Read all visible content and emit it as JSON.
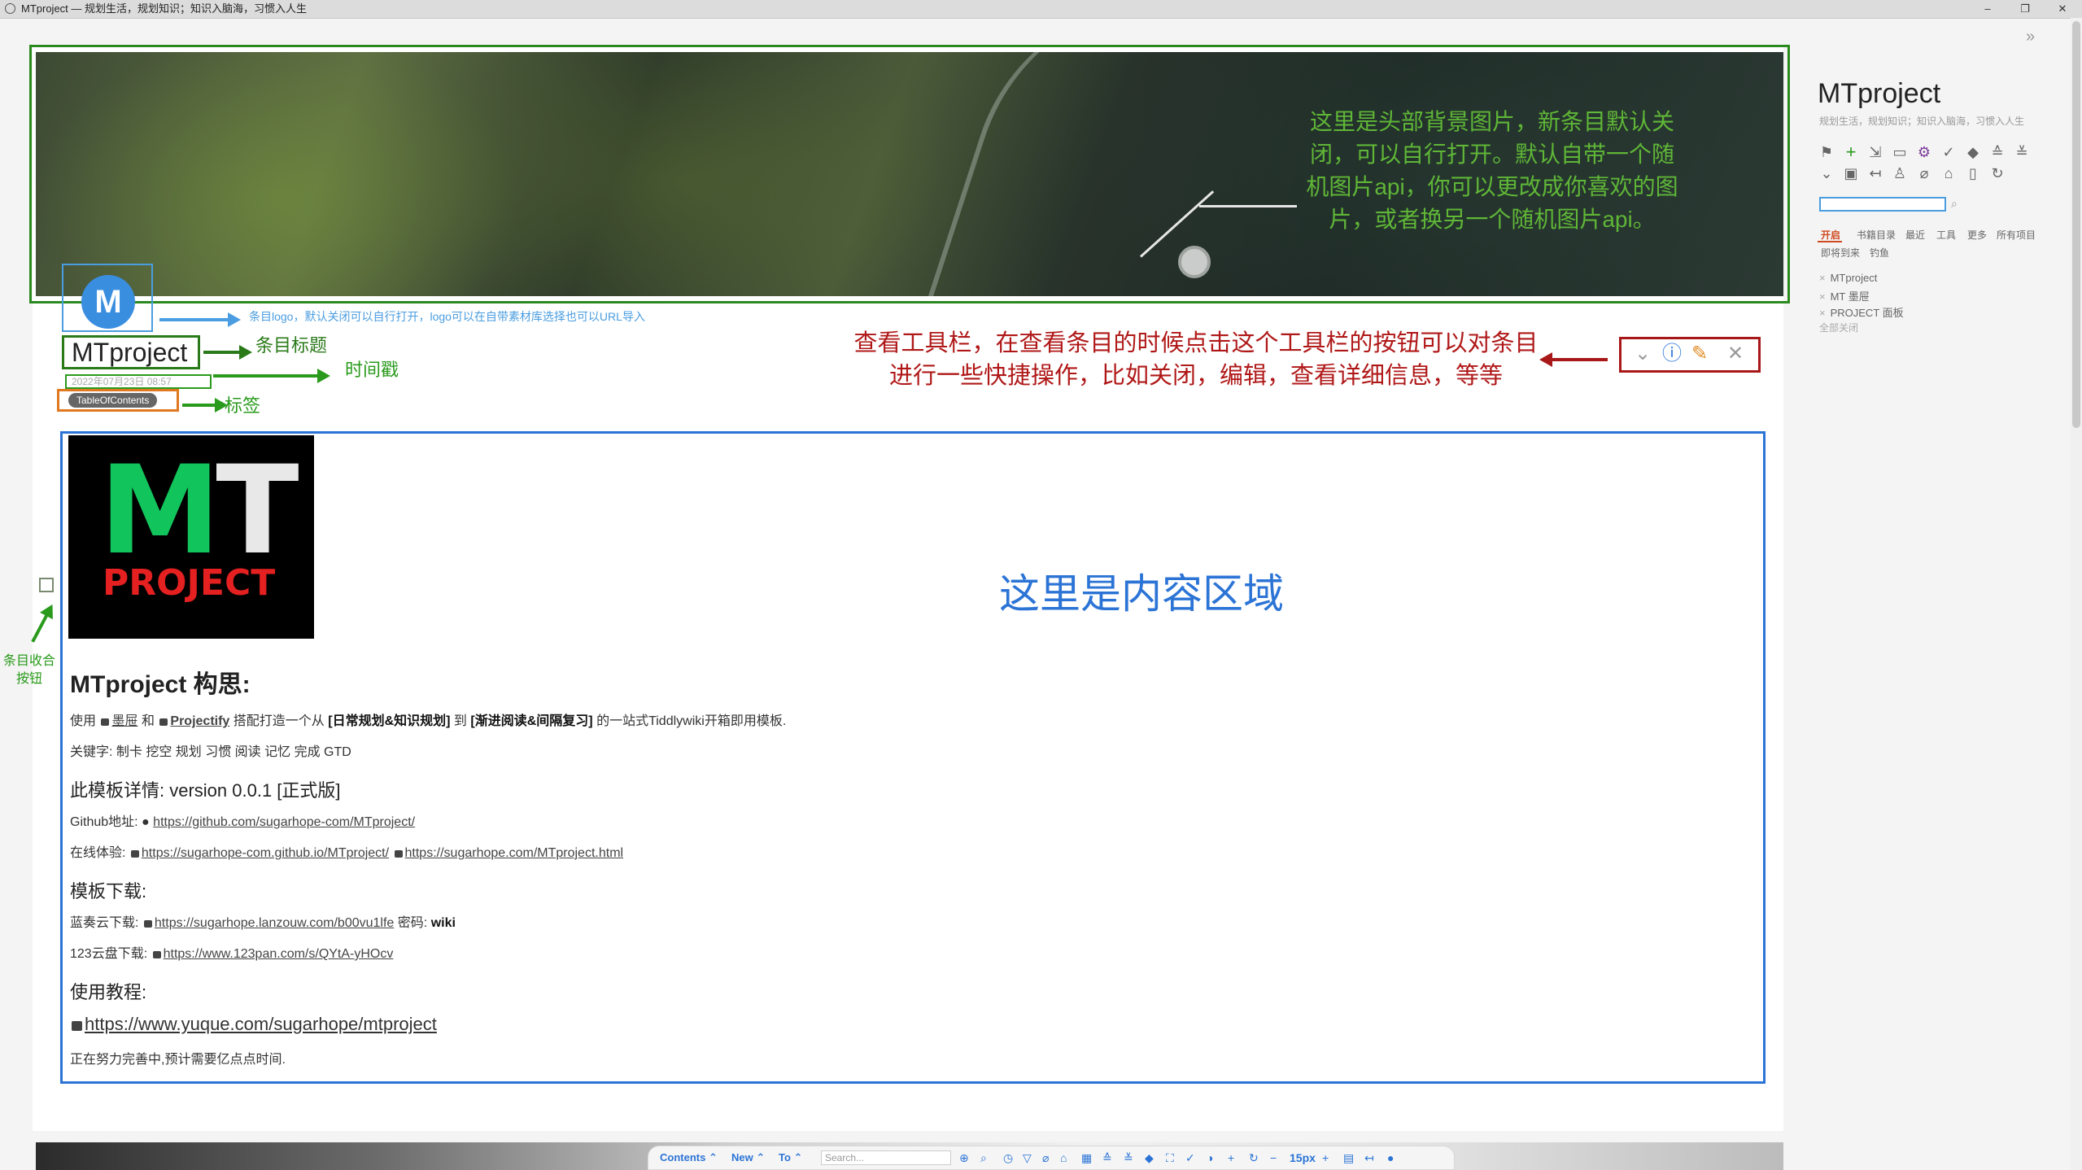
{
  "window": {
    "title": "MTproject — 规划生活，规划知识；知识入脑海，习惯入人生",
    "min": "–",
    "max": "❐",
    "close": "✕"
  },
  "header": {
    "annotation": "这里是头部背景图片，新条目默认关闭，可以自行打开。默认自带一个随机图片api，你可以更改成你喜欢的图片，或者换另一个随机图片api。"
  },
  "tiddler": {
    "logo_letter": "M",
    "logo_annotation": "条目logo，默认关闭可以自行打开，logo可以在自带素材库选择也可以URL导入",
    "title": "MTproject",
    "title_annotation": "条目标题",
    "timestamp": "2022年07月23日 08:57",
    "timestamp_annotation": "时间戳",
    "tag": "TableOfContents",
    "tag_annotation": "标签",
    "toolbar_annotation": "查看工具栏，在查看条目的时候点击这个工具栏的按钮可以对条目进行一些快捷操作，比如关闭，编辑，查看详细信息，等等",
    "toolbar_icons": [
      "chevron-down-icon",
      "info-icon",
      "edit-icon",
      "close-icon"
    ],
    "collapse_annotation": "条目收合按钮"
  },
  "content": {
    "logo_mt_left": "M",
    "logo_mt_right": "T",
    "logo_project": "PROJECT",
    "area_label": "这里是内容区域",
    "heading": "MTproject 构思:",
    "intro_prefix": "使用",
    "intro_link1": "墨屉",
    "intro_and": "和",
    "intro_link2": "Projectify",
    "intro_mid": "搭配打造一个从",
    "intro_bold1": "[日常规划&知识规划]",
    "intro_to": "到",
    "intro_bold2": "[渐进阅读&间隔复习]",
    "intro_suffix": "的一站式Tiddlywiki开箱即用模板.",
    "keywords": "关键字: 制卡 挖空 规划 习惯 阅读 记忆 完成 GTD",
    "version": "此模板详情: version 0.0.1 [正式版]",
    "github_label": "Github地址:",
    "github_url": "https://github.com/sugarhope-com/MTproject/",
    "demo_label": "在线体验:",
    "demo_url1": "https://sugarhope-com.github.io/MTproject/",
    "demo_url2": "https://sugarhope.com/MTproject.html",
    "download_heading": "模板下载:",
    "lanzou_label": "蓝奏云下载:",
    "lanzou_url": "https://sugarhope.lanzouw.com/b00vu1lfe",
    "lanzou_pwd_label": "密码:",
    "lanzou_pwd": "wiki",
    "pan123_label": "123云盘下载:",
    "pan123_url": "https://www.123pan.com/s/QYtA-yHOcv",
    "tutorial_heading": "使用教程:",
    "tutorial_url": "https://www.yuque.com/sugarhope/mtproject",
    "footer_note": "正在努力完善中,预计需要亿点点时间."
  },
  "bottombar": {
    "contents": "Contents ⌃",
    "new": "New ⌃",
    "to": "To ⌃",
    "search_placeholder": "Search...",
    "font_size": "15px"
  },
  "sidebar": {
    "title": "MTproject",
    "subtitle": "规划生活，规划知识；知识入脑海，习惯入人生",
    "tabs": [
      "开启",
      "书籍目录",
      "最近",
      "工具",
      "更多",
      "所有项目"
    ],
    "tabs_row2": [
      "即将到来",
      "钓鱼"
    ],
    "open_items": [
      "MTproject",
      "MT 墨屉",
      "PROJECT 面板"
    ],
    "close_all": "全部关闭"
  },
  "colors": {
    "annotation_green": "#2a9a1c",
    "annotation_blue": "#4a9de0",
    "annotation_red": "#b01818",
    "content_blue": "#2b74d6",
    "logo_green": "#12c45c",
    "logo_red": "#e42020"
  }
}
